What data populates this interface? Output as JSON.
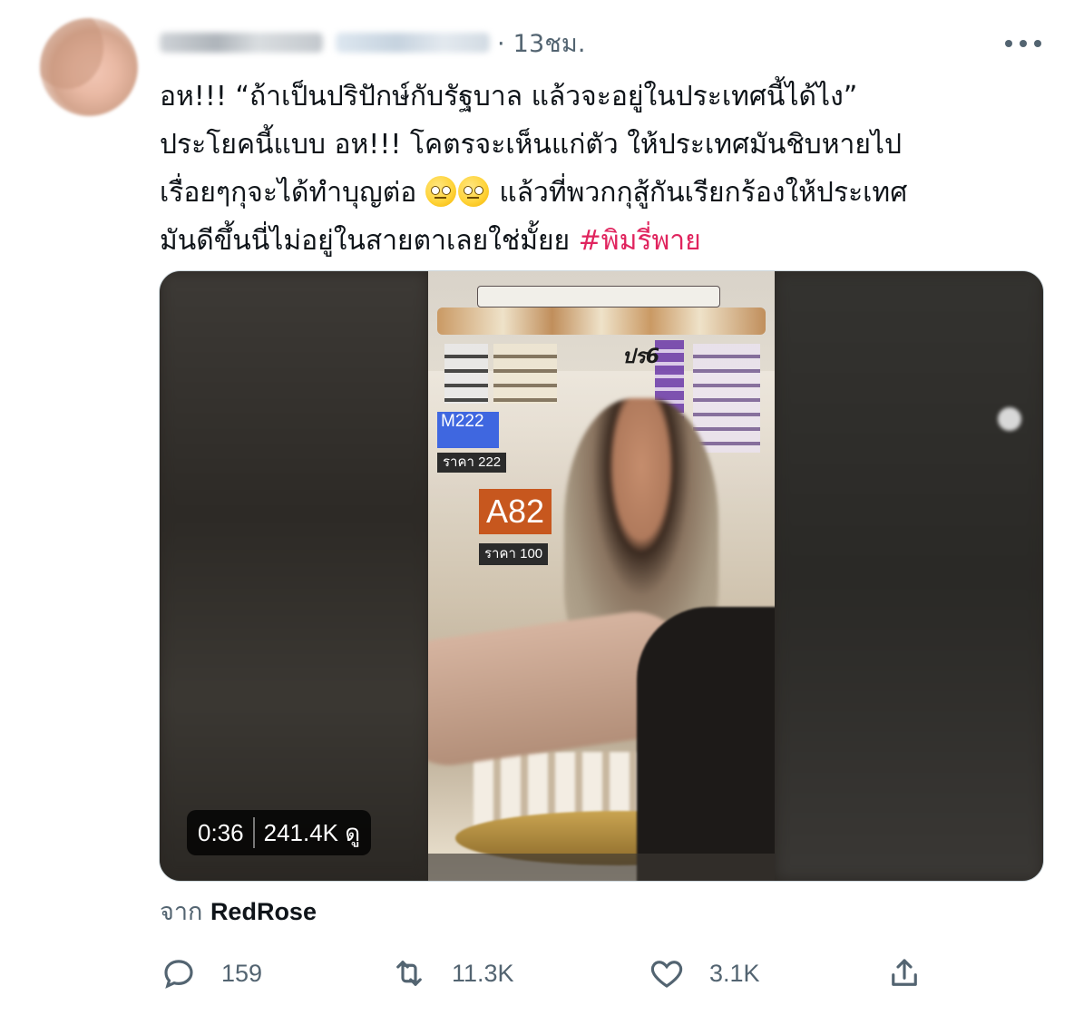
{
  "tweet": {
    "time": "13ชม.",
    "lines": [
      "อห!!! “ถ้าเป็นปริปักษ์กับรัฐบาล แล้วจะอยู่ในประเทศนี้ได้ไง”",
      "ประโยคนี้แบบ อห!!! โคตรจะเห็นแก่ตัว ให้ประเทศมันชิบหายไป",
      "เรื่อยๆกุจะได้ทำบุญต่อ",
      "แล้วที่พวกกุสู้กันเรียกร้องให้ประเทศ",
      "มันดีขึ้นนี่ไม่อยู่ในสายตาเลยใช่มั้ยย"
    ],
    "hashtag": "#พิมรี่พาย",
    "emoji": "face-with-rolling-eyes-icon"
  },
  "video": {
    "overlay": {
      "m_code": "M222",
      "price_m": "ราคา 222",
      "a_code": "A82",
      "price_a": "ราคา 100",
      "ps_code": "ปร6"
    },
    "duration": "0:36",
    "views": "241.4K ดู"
  },
  "source": {
    "prefix": "จาก",
    "name": "RedRose"
  },
  "actions": {
    "replies": "159",
    "retweets": "11.3K",
    "likes": "3.1K"
  },
  "colors": {
    "hashtag": "#e0245e",
    "secondary_text": "#536471",
    "primary_text": "#0f1419"
  }
}
